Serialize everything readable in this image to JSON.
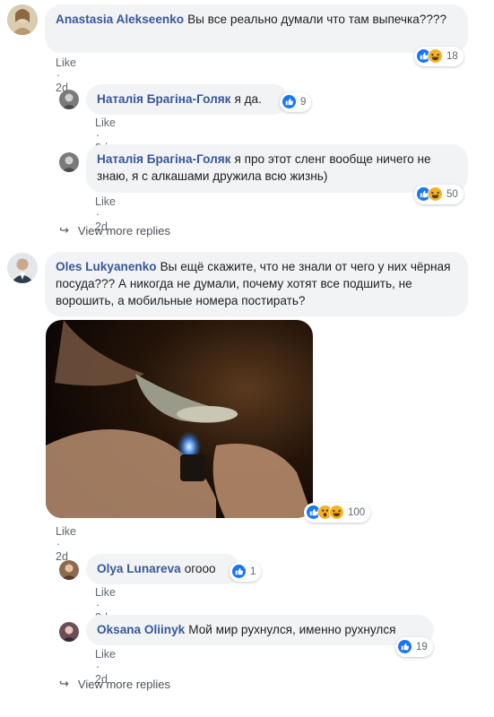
{
  "comments": [
    {
      "author": "Anastasia Alekseenko",
      "text": "Вы все реально думали что там выпечка????",
      "like_label": "Like",
      "time": "2d",
      "reaction_count": "18",
      "reactions": [
        "like-icon",
        "haha-icon"
      ]
    },
    {
      "author": "Наталія Брагіна-Голяк",
      "text": "я да.",
      "like_label": "Like",
      "time": "2d",
      "reaction_count": "9",
      "reactions": [
        "like-icon"
      ]
    },
    {
      "author": "Наталія Брагіна-Голяк",
      "text": "я про этот сленг вообще ничего не знаю, я с алкашами дружила всю жизнь)",
      "like_label": "Like",
      "time": "2d",
      "reaction_count": "50",
      "reactions": [
        "like-icon",
        "haha-icon"
      ]
    },
    {
      "author": "Oles Lukyanenko",
      "text": "Вы ещё скажите, что не знали от чего у них чёрная посуда??? А никогда не думали, почему хотят все подшить, не ворошить, а мобильные номера постирать?",
      "like_label": "Like",
      "time": "2d",
      "reaction_count": "100",
      "reactions": [
        "like-icon",
        "wow-icon",
        "haha-icon"
      ]
    },
    {
      "author": "Olya Lunareva",
      "text": "огооо",
      "like_label": "Like",
      "time": "2d",
      "reaction_count": "1",
      "reactions": [
        "like-icon"
      ]
    },
    {
      "author": "Oksana Oliinyk",
      "text": "Мой мир рухнулся, именно рухнулся",
      "like_label": "Like",
      "time": "2d",
      "reaction_count": "19",
      "reactions": [
        "like-icon"
      ]
    }
  ],
  "view_more_replies": [
    "View more replies",
    "View more replies"
  ],
  "colors": {
    "link": "#385898",
    "bubble": "#f2f3f5",
    "like_blue": "#1877f2",
    "haha_yellow": "#f7b125"
  }
}
